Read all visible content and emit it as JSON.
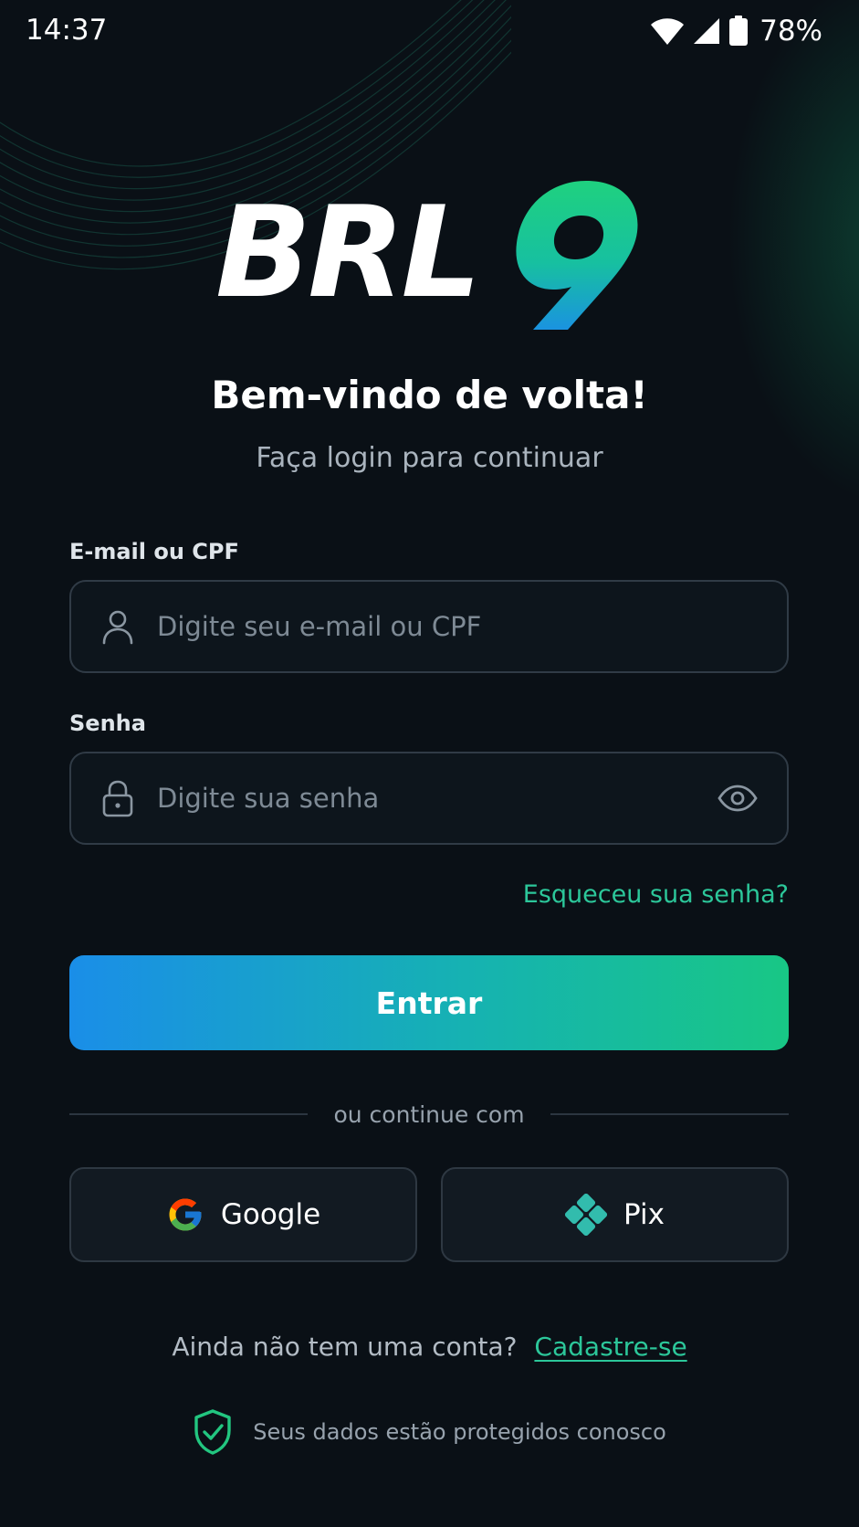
{
  "status_bar": {
    "time": "14:37",
    "battery": "78%",
    "icons": [
      "wifi-icon",
      "signal-icon",
      "battery-icon"
    ]
  },
  "brand": {
    "logo_text": "BRL",
    "logo_digit": "9"
  },
  "header": {
    "title": "Bem-vindo de volta!",
    "subtitle": "Faça login para continuar"
  },
  "form": {
    "email": {
      "label": "E-mail ou CPF",
      "placeholder": "Digite seu e-mail ou CPF",
      "value": "",
      "icon": "user-icon"
    },
    "password": {
      "label": "Senha",
      "placeholder": "Digite sua senha",
      "value": "",
      "icon": "lock-icon",
      "toggle_icon": "eye-icon"
    },
    "forgot_password": "Esqueceu sua senha?",
    "submit_label": "Entrar"
  },
  "social": {
    "divider_text": "ou continue com",
    "google_label": "Google",
    "pix_label": "Pix"
  },
  "signup": {
    "prompt": "Ainda não tem uma conta?",
    "link": "Cadastre-se"
  },
  "security": {
    "text": "Seus dados estão protegidos conosco",
    "icon": "shield-check-icon"
  },
  "colors": {
    "background": "#0a1016",
    "accent": "#2cc79a",
    "button_gradient_start": "#1a8ee8",
    "button_gradient_end": "#18c785"
  }
}
